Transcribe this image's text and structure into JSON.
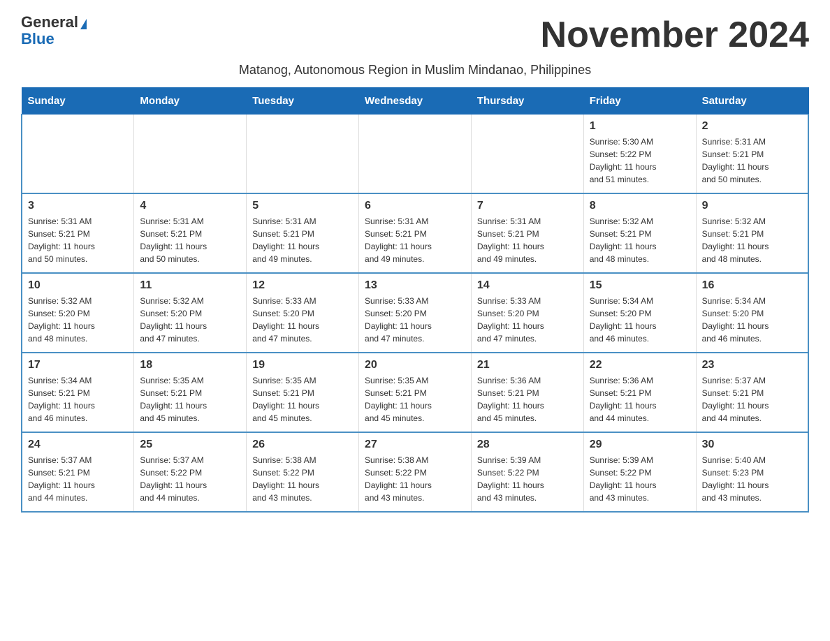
{
  "header": {
    "logo_general": "General",
    "logo_blue": "Blue",
    "month_title": "November 2024",
    "subtitle": "Matanog, Autonomous Region in Muslim Mindanao, Philippines"
  },
  "weekdays": [
    "Sunday",
    "Monday",
    "Tuesday",
    "Wednesday",
    "Thursday",
    "Friday",
    "Saturday"
  ],
  "weeks": [
    [
      {
        "day": "",
        "info": ""
      },
      {
        "day": "",
        "info": ""
      },
      {
        "day": "",
        "info": ""
      },
      {
        "day": "",
        "info": ""
      },
      {
        "day": "",
        "info": ""
      },
      {
        "day": "1",
        "info": "Sunrise: 5:30 AM\nSunset: 5:22 PM\nDaylight: 11 hours\nand 51 minutes."
      },
      {
        "day": "2",
        "info": "Sunrise: 5:31 AM\nSunset: 5:21 PM\nDaylight: 11 hours\nand 50 minutes."
      }
    ],
    [
      {
        "day": "3",
        "info": "Sunrise: 5:31 AM\nSunset: 5:21 PM\nDaylight: 11 hours\nand 50 minutes."
      },
      {
        "day": "4",
        "info": "Sunrise: 5:31 AM\nSunset: 5:21 PM\nDaylight: 11 hours\nand 50 minutes."
      },
      {
        "day": "5",
        "info": "Sunrise: 5:31 AM\nSunset: 5:21 PM\nDaylight: 11 hours\nand 49 minutes."
      },
      {
        "day": "6",
        "info": "Sunrise: 5:31 AM\nSunset: 5:21 PM\nDaylight: 11 hours\nand 49 minutes."
      },
      {
        "day": "7",
        "info": "Sunrise: 5:31 AM\nSunset: 5:21 PM\nDaylight: 11 hours\nand 49 minutes."
      },
      {
        "day": "8",
        "info": "Sunrise: 5:32 AM\nSunset: 5:21 PM\nDaylight: 11 hours\nand 48 minutes."
      },
      {
        "day": "9",
        "info": "Sunrise: 5:32 AM\nSunset: 5:21 PM\nDaylight: 11 hours\nand 48 minutes."
      }
    ],
    [
      {
        "day": "10",
        "info": "Sunrise: 5:32 AM\nSunset: 5:20 PM\nDaylight: 11 hours\nand 48 minutes."
      },
      {
        "day": "11",
        "info": "Sunrise: 5:32 AM\nSunset: 5:20 PM\nDaylight: 11 hours\nand 47 minutes."
      },
      {
        "day": "12",
        "info": "Sunrise: 5:33 AM\nSunset: 5:20 PM\nDaylight: 11 hours\nand 47 minutes."
      },
      {
        "day": "13",
        "info": "Sunrise: 5:33 AM\nSunset: 5:20 PM\nDaylight: 11 hours\nand 47 minutes."
      },
      {
        "day": "14",
        "info": "Sunrise: 5:33 AM\nSunset: 5:20 PM\nDaylight: 11 hours\nand 47 minutes."
      },
      {
        "day": "15",
        "info": "Sunrise: 5:34 AM\nSunset: 5:20 PM\nDaylight: 11 hours\nand 46 minutes."
      },
      {
        "day": "16",
        "info": "Sunrise: 5:34 AM\nSunset: 5:20 PM\nDaylight: 11 hours\nand 46 minutes."
      }
    ],
    [
      {
        "day": "17",
        "info": "Sunrise: 5:34 AM\nSunset: 5:21 PM\nDaylight: 11 hours\nand 46 minutes."
      },
      {
        "day": "18",
        "info": "Sunrise: 5:35 AM\nSunset: 5:21 PM\nDaylight: 11 hours\nand 45 minutes."
      },
      {
        "day": "19",
        "info": "Sunrise: 5:35 AM\nSunset: 5:21 PM\nDaylight: 11 hours\nand 45 minutes."
      },
      {
        "day": "20",
        "info": "Sunrise: 5:35 AM\nSunset: 5:21 PM\nDaylight: 11 hours\nand 45 minutes."
      },
      {
        "day": "21",
        "info": "Sunrise: 5:36 AM\nSunset: 5:21 PM\nDaylight: 11 hours\nand 45 minutes."
      },
      {
        "day": "22",
        "info": "Sunrise: 5:36 AM\nSunset: 5:21 PM\nDaylight: 11 hours\nand 44 minutes."
      },
      {
        "day": "23",
        "info": "Sunrise: 5:37 AM\nSunset: 5:21 PM\nDaylight: 11 hours\nand 44 minutes."
      }
    ],
    [
      {
        "day": "24",
        "info": "Sunrise: 5:37 AM\nSunset: 5:21 PM\nDaylight: 11 hours\nand 44 minutes."
      },
      {
        "day": "25",
        "info": "Sunrise: 5:37 AM\nSunset: 5:22 PM\nDaylight: 11 hours\nand 44 minutes."
      },
      {
        "day": "26",
        "info": "Sunrise: 5:38 AM\nSunset: 5:22 PM\nDaylight: 11 hours\nand 43 minutes."
      },
      {
        "day": "27",
        "info": "Sunrise: 5:38 AM\nSunset: 5:22 PM\nDaylight: 11 hours\nand 43 minutes."
      },
      {
        "day": "28",
        "info": "Sunrise: 5:39 AM\nSunset: 5:22 PM\nDaylight: 11 hours\nand 43 minutes."
      },
      {
        "day": "29",
        "info": "Sunrise: 5:39 AM\nSunset: 5:22 PM\nDaylight: 11 hours\nand 43 minutes."
      },
      {
        "day": "30",
        "info": "Sunrise: 5:40 AM\nSunset: 5:23 PM\nDaylight: 11 hours\nand 43 minutes."
      }
    ]
  ]
}
